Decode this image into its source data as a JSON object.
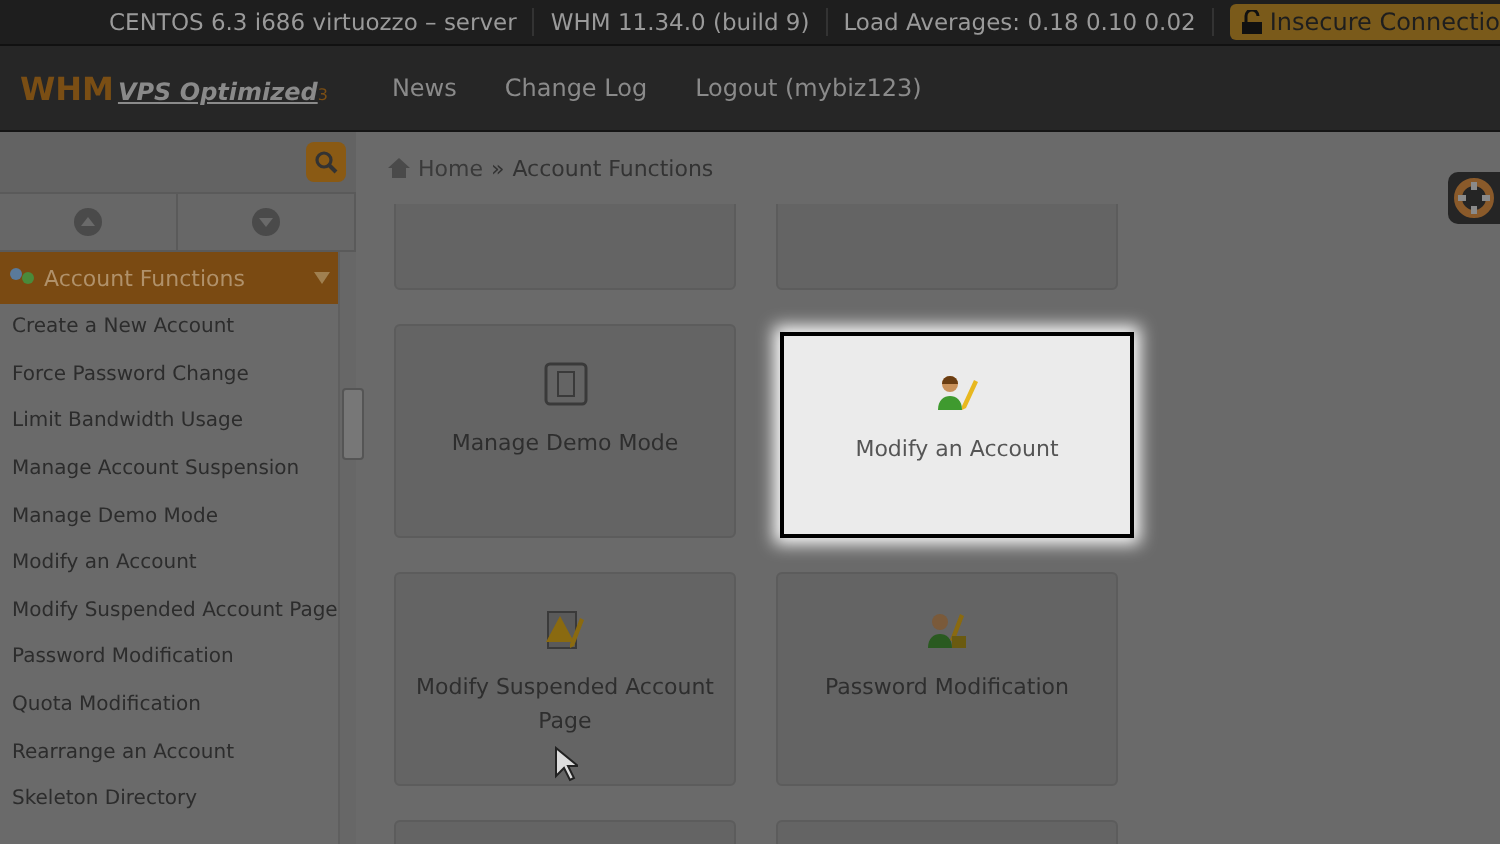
{
  "status_bar": {
    "items": [
      "CENTOS 6.3 i686 virtuozzo – server",
      "WHM 11.34.0 (build 9)",
      "Load Averages: 0.18 0.10 0.02"
    ],
    "security": "Insecure Connectio"
  },
  "header": {
    "logo": {
      "main": "WHM",
      "sub": "VPS Optimized",
      "mark": "3"
    },
    "nav": [
      "News",
      "Change Log",
      "Logout (mybiz123)"
    ]
  },
  "sidebar": {
    "group": {
      "label": "Account Functions",
      "expanded": true
    },
    "items": [
      "Create a New Account",
      "Force Password Change",
      "Limit Bandwidth Usage",
      "Manage Account Suspension",
      "Manage Demo Mode",
      "Modify an Account",
      "Modify Suspended Account Page",
      "Password Modification",
      "Quota Modification",
      "Rearrange an Account",
      "Skeleton Directory"
    ]
  },
  "breadcrumb": {
    "home": "Home",
    "separator": "»",
    "current": "Account Functions"
  },
  "tiles": [
    {
      "label": "Manage Demo Mode",
      "kind": "switch",
      "selected": false
    },
    {
      "label": "Modify an Account",
      "kind": "user-pencil",
      "selected": true
    },
    {
      "label": "Modify Suspended Account Page",
      "kind": "warning-pencil",
      "selected": false
    },
    {
      "label": "Password Modification",
      "kind": "user-lock",
      "selected": false
    }
  ]
}
